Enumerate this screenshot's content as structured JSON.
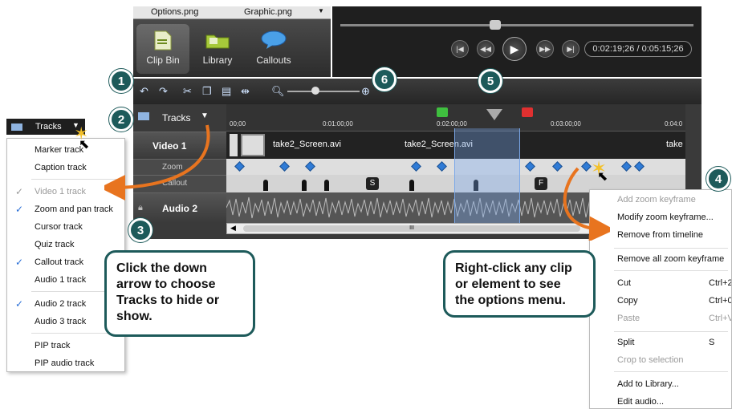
{
  "file_tabs": [
    "Options.png",
    "Graphic.png"
  ],
  "bin_tabs": [
    {
      "label": "Clip Bin",
      "icon": "clip-bin-icon"
    },
    {
      "label": "Library",
      "icon": "library-folder-icon"
    },
    {
      "label": "Callouts",
      "icon": "callout-bubble-icon"
    }
  ],
  "player": {
    "time": "0:02:19;26 / 0:05:15;26"
  },
  "timeline": {
    "tracks_label": "Tracks",
    "ruler_ticks": [
      "00;00",
      "0:01:00;00",
      "0:02:00;00",
      "0:03:00;00",
      "0:04:0"
    ],
    "tracks": [
      {
        "label": "Video 1"
      },
      {
        "label": "Zoom"
      },
      {
        "label": "Callout"
      },
      {
        "label": "Audio 2"
      }
    ],
    "clips": [
      "take2_Screen.avi",
      "take2_Screen.avi",
      "take"
    ],
    "callout_letters": [
      "S",
      "F"
    ],
    "scrollbar_label": "III"
  },
  "tracks_menu": {
    "title": "Tracks",
    "items": [
      {
        "label": "Marker track",
        "checked": false,
        "disabled": false
      },
      {
        "label": "Caption track",
        "checked": false,
        "disabled": false
      },
      {
        "label": "Video 1 track",
        "checked": true,
        "disabled": true
      },
      {
        "label": "Zoom and pan track",
        "checked": true,
        "disabled": false
      },
      {
        "label": "Cursor track",
        "checked": false,
        "disabled": false
      },
      {
        "label": "Quiz track",
        "checked": false,
        "disabled": false
      },
      {
        "label": "Callout track",
        "checked": true,
        "disabled": false
      },
      {
        "label": "Audio 1 track",
        "checked": false,
        "disabled": false
      },
      {
        "label": "Audio 2 track",
        "checked": true,
        "disabled": false
      },
      {
        "label": "Audio 3 track",
        "checked": false,
        "disabled": false
      },
      {
        "label": "PIP track",
        "checked": false,
        "disabled": false
      },
      {
        "label": "PIP audio track",
        "checked": false,
        "disabled": false
      }
    ]
  },
  "context_menu": {
    "items": [
      {
        "label": "Add zoom keyframe",
        "shortcut": "",
        "disabled": true
      },
      {
        "label": "Modify zoom keyframe...",
        "shortcut": "",
        "disabled": false
      },
      {
        "label": "Remove from timeline",
        "shortcut": "",
        "disabled": false
      },
      {
        "label": "Remove all zoom keyframe",
        "shortcut": "",
        "disabled": false
      },
      {
        "label": "Cut",
        "shortcut": "Ctrl+2",
        "disabled": false
      },
      {
        "label": "Copy",
        "shortcut": "Ctrl+0",
        "disabled": false
      },
      {
        "label": "Paste",
        "shortcut": "Ctrl+V",
        "disabled": true
      },
      {
        "label": "Split",
        "shortcut": "S",
        "disabled": false
      },
      {
        "label": "Crop to selection",
        "shortcut": "",
        "disabled": true
      },
      {
        "label": "Add to Library...",
        "shortcut": "",
        "disabled": false
      },
      {
        "label": "Edit audio...",
        "shortcut": "",
        "disabled": false
      }
    ]
  },
  "badges": [
    "1",
    "2",
    "3",
    "4",
    "5",
    "6"
  ],
  "callouts": {
    "tracks_tip": "Click the down arrow to choose Tracks to hide or show.",
    "rightclick_tip": "Right-click any clip or element to see the options menu."
  },
  "colors": {
    "badge": "#1d5a5a",
    "arrow": "#e8741f",
    "check": "#2a6fd6",
    "selection": "#78aaf0"
  }
}
